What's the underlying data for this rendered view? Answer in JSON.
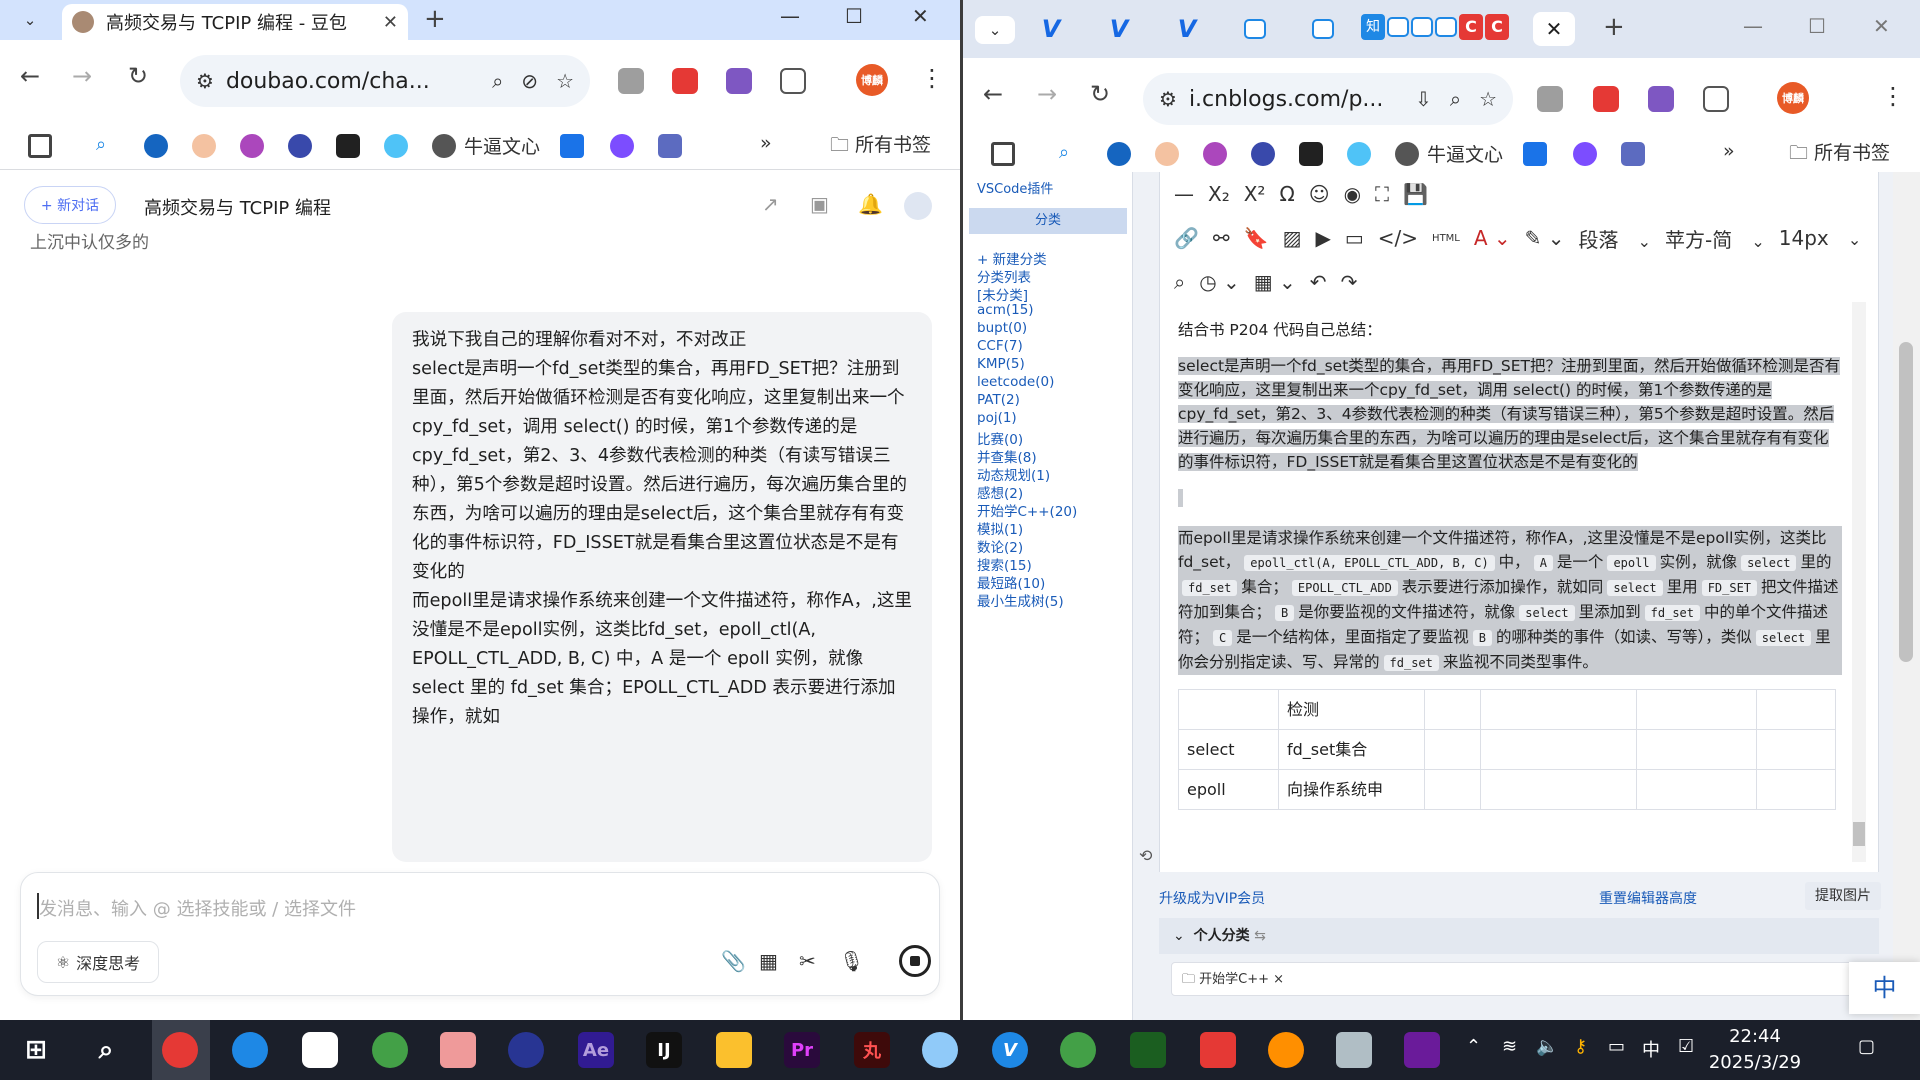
{
  "left": {
    "tab_title": "高频交易与 TCPIP 编程 - 豆包",
    "url": "doubao.com/cha...",
    "bookmarks": {
      "wenxin": "牛逼文心",
      "all": "所有书签"
    },
    "avatar_label": "博麟",
    "chat": {
      "new_chat": "+ 新对话",
      "title": "高频交易与 TCPIP 编程",
      "cut_text": "上沉中认仅多的",
      "message": [
        "我说下我自己的理解你看对不对，不对改正",
        "",
        "",
        "select是声明一个fd_set类型的集合，再用FD_SET把？注册到里面，然后开始做循环检测是否有变化响应，这里复制出来一个cpy_fd_set，调用 select() 的时候，第1个参数传递的是cpy_fd_set，第2、3、4参数代表检测的种类（有读写错误三种），第5个参数是超时设置。然后进行遍历，每次遍历集合里的东西，为啥可以遍历的理由是select后，这个集合里就存有有变化的事件标识符，FD_ISSET就是看集合里这置位状态是不是有变化的",
        "",
        "",
        "",
        "而epoll里是请求操作系统来创建一个文件描述符，称作A，,这里没懂是不是epoll实例，这类比fd_set，epoll_ctl(A, EPOLL_CTL_ADD, B, C) 中，A 是一个 epoll 实例，就像 select 里的 fd_set 集合；EPOLL_CTL_ADD 表示要进行添加操作，就如"
      ],
      "input_placeholder": "发消息、输入 @ 选择技能或 / 选择文件",
      "deep_think": "深度思考"
    }
  },
  "right": {
    "url": "i.cnblogs.com/p...",
    "bookmarks": {
      "wenxin": "牛逼文心",
      "all": "所有书签"
    },
    "avatar_label": "博麟",
    "minitabs": [
      "知",
      "C",
      "C"
    ],
    "sidebar": {
      "top": "VSCode插件",
      "header": "分类",
      "items": [
        "+ 新建分类",
        "分类列表",
        "[未分类]",
        "acm(15)",
        "bupt(0)",
        "CCF(7)",
        "KMP(5)",
        "leetcode(0)",
        "PAT(2)",
        "poj(1)",
        "比赛(0)",
        "并查集(8)",
        "动态规划(1)",
        "感想(2)",
        "开始学C++(20)",
        "模拟(1)",
        "数论(2)",
        "搜索(15)",
        "最短路(10)",
        "最小生成树(5)"
      ]
    },
    "editor": {
      "tb_para": "段落",
      "tb_font": "苹方-简",
      "tb_size": "14px",
      "tb_html": "HTML",
      "heading": "结合书 P204 代码自己总结：",
      "para1": "select是声明一个fd_set类型的集合，再用FD_SET把？注册到里面，然后开始做循环检测是否有变化响应，这里复制出来一个cpy_fd_set，调用 select() 的时候，第1个参数传递的是cpy_fd_set，第2、3、4参数代表检测的种类（有读写错误三种），第5个参数是超时设置。然后进行遍历，每次遍历集合里的东西，为啥可以遍历的理由是select后，这个集合里就存有有变化的事件标识符，FD_ISSET就是看集合里这置位状态是不是有变化的",
      "p2": {
        "t1": "而epoll里是请求操作系统来创建一个文件描述符，称作A，,这里没懂是不是epoll实例，这类比fd_set，",
        "c1": "epoll_ctl(A, EPOLL_CTL_ADD, B, C)",
        "t2": "中，",
        "c2": "A",
        "t3": "是一个",
        "c3": "epoll",
        "t4": "实例，就像",
        "c4": "select",
        "t5": "里的",
        "c5": "fd_set",
        "t6": "集合；",
        "c6": "EPOLL_CTL_ADD",
        "t7": "表示要进行添加操作，就如同",
        "c7": "select",
        "t8": "里用",
        "c8": "FD_SET",
        "t9": "把文件描述符加到集合；",
        "c9": "B",
        "t10": "是你要监视的文件描述符，就像",
        "c10": "select",
        "t11": "里添加到",
        "c11": "fd_set",
        "t12": "中的单个文件描述符；",
        "c12": "C",
        "t13": "是一个结构体，里面指定了要监视",
        "c13": "B",
        "t14": "的哪种类的事件（如读、写等），类似",
        "c14": "select",
        "t15": "里你会分别指定读、写、异常的",
        "c15": "fd_set",
        "t16": "来监视不同类型事件。"
      },
      "table": {
        "r1c2": "检测",
        "r2c1": "select",
        "r2c2": "fd_set集合",
        "r3c1": "epoll",
        "r3c2": "向操作系统申"
      }
    },
    "below": {
      "vip": "升级成为VIP会员",
      "reset": "重置编辑器高度",
      "extract": "提取图片",
      "category": "个人分类",
      "tag": "开始学C++ ×"
    },
    "ime": "中"
  },
  "taskbar": {
    "time": "22:44",
    "date": "2025/3/29",
    "ime": "中"
  }
}
